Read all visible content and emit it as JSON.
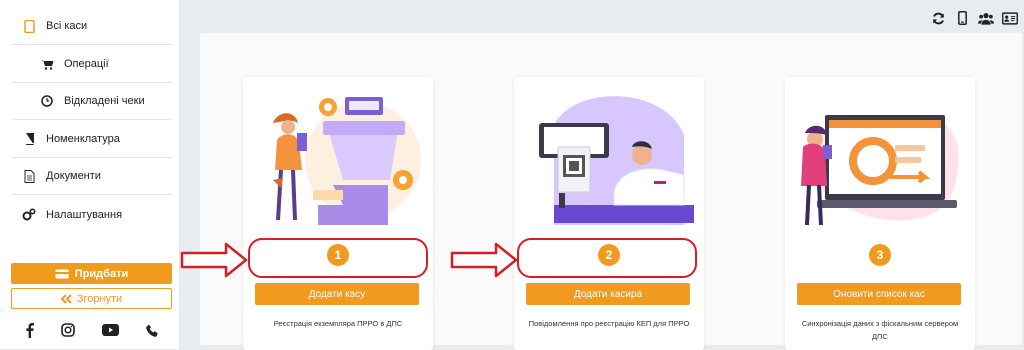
{
  "sidebar": {
    "items": [
      {
        "label": "Всі каси",
        "icon": "tablet-icon"
      },
      {
        "label": "Операції",
        "icon": "cart-icon"
      },
      {
        "label": "Відкладені чеки",
        "icon": "clock-icon"
      },
      {
        "label": "Номенклатура",
        "icon": "book-icon"
      },
      {
        "label": "Документи",
        "icon": "document-icon"
      },
      {
        "label": "Налаштування",
        "icon": "gears-icon"
      }
    ],
    "buy_label": "Придбати",
    "collapse_label": "Згорнути"
  },
  "toolbar": {
    "icons": [
      "refresh-icon",
      "mobile-icon",
      "users-icon",
      "id-card-icon"
    ]
  },
  "steps": [
    {
      "number": "1",
      "button": "Додати касу",
      "description": "Реєстрація екземпляра ПРРО в ДПС"
    },
    {
      "number": "2",
      "button": "Додати касира",
      "description": "Повідомлення про реєстрацію КЕП для ПРРО"
    },
    {
      "number": "3",
      "button": "Оновити список кас",
      "description": "Синхронізація даних з фіскальним сервером ДПС"
    }
  ],
  "colors": {
    "accent": "#f09a1e",
    "annotation": "#d41f26",
    "illustration_purple": "#7b5fd6"
  }
}
